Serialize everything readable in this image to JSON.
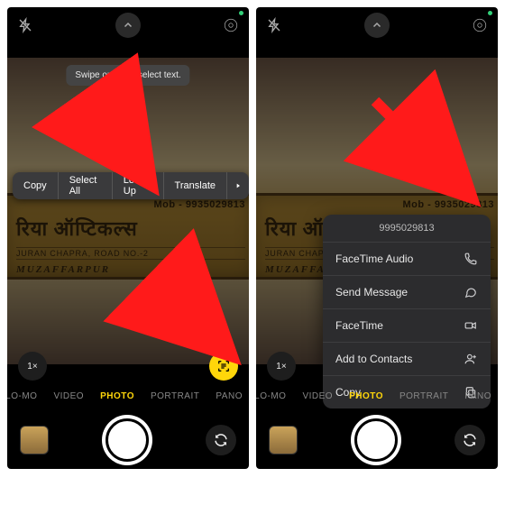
{
  "tooltip": "Swipe or tap to select text.",
  "textMenu": {
    "copy": "Copy",
    "selectAll": "Select All",
    "lookUp": "Look Up",
    "translate": "Translate"
  },
  "plaque": {
    "phone": "Mob - 9935029813",
    "name": "रिया ऑप्टिकल्स",
    "address": "JURAN CHAPRA, ROAD NO.-2",
    "city": "MUZAFFARPUR"
  },
  "zoom": "1×",
  "modes": {
    "slomo": "SLO-MO",
    "video": "VIDEO",
    "photo": "PHOTO",
    "portrait": "PORTRAIT",
    "pano": "PANO"
  },
  "sheet": {
    "number": "9995029813",
    "facetimeAudio": "FaceTime Audio",
    "sendMessage": "Send Message",
    "facetime": "FaceTime",
    "addContacts": "Add to Contacts",
    "copy": "Copy"
  }
}
